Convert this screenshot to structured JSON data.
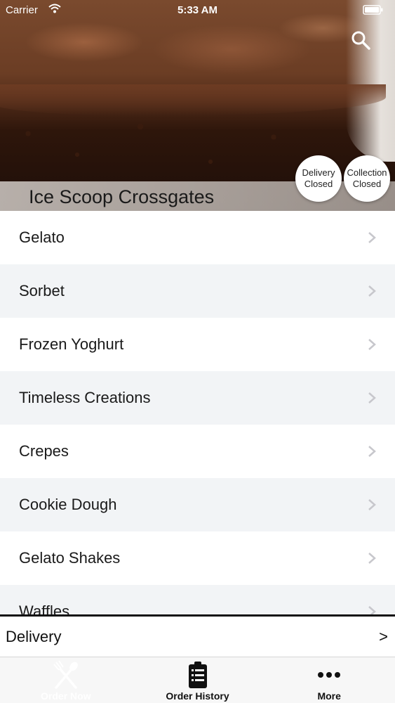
{
  "status_bar": {
    "carrier": "Carrier",
    "time": "5:33 AM"
  },
  "hero": {
    "store_name": "Ice Scoop Crossgates",
    "delivery_status": {
      "line1": "Delivery",
      "line2": "Closed"
    },
    "collection_status": {
      "line1": "Collection",
      "line2": "Closed"
    }
  },
  "categories": [
    {
      "label": "Gelato"
    },
    {
      "label": "Sorbet"
    },
    {
      "label": "Frozen Yoghurt"
    },
    {
      "label": "Timeless Creations"
    },
    {
      "label": "Crepes"
    },
    {
      "label": "Cookie Dough"
    },
    {
      "label": "Gelato Shakes"
    },
    {
      "label": "Waffles"
    }
  ],
  "delivery_bar": {
    "label": "Delivery",
    "arrow": ">"
  },
  "tab_bar": {
    "tabs": [
      {
        "label": "Order Now",
        "icon": "fork-spoon-icon",
        "active": true
      },
      {
        "label": "Order History",
        "icon": "clipboard-list-icon",
        "active": false
      },
      {
        "label": "More",
        "icon": "more-dots-icon",
        "active": false
      }
    ]
  },
  "colors": {
    "row_alt": "#f2f4f6",
    "chevron": "#c7c7cc",
    "tab_bar_bg": "#f7f7f7"
  }
}
